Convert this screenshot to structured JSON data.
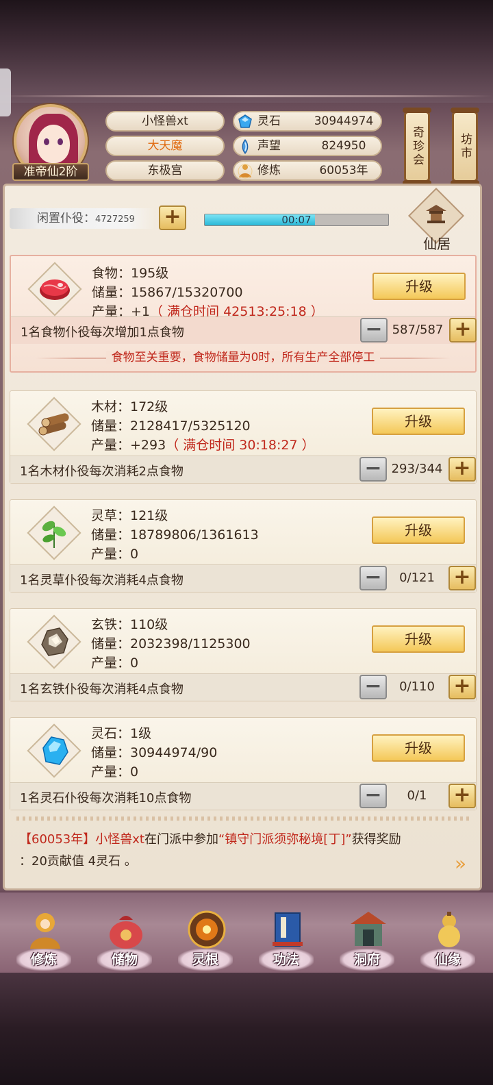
{
  "player": {
    "name": "小怪兽xt",
    "title": "大天魔",
    "location": "东极宫",
    "rank": "准帝仙2阶"
  },
  "resources": [
    {
      "icon": "spirit-stone-icon",
      "label": "灵石",
      "value": "30944974"
    },
    {
      "icon": "prestige-icon",
      "label": "声望",
      "value": "824950"
    },
    {
      "icon": "cultivation-icon",
      "label": "修炼",
      "value": "60053年"
    }
  ],
  "side_buttons": {
    "treasure": "奇珍会",
    "market": "坊市"
  },
  "idle": {
    "label": "闲置仆役：",
    "count": "4727259"
  },
  "timer": {
    "text": "00:07",
    "progress": 0.6
  },
  "xianju": {
    "label": "仙居"
  },
  "cards": [
    {
      "icon": "meat-icon",
      "name_line": "食物：195级",
      "storage_line": "储量：15867/15320700",
      "output_prefix": "产量：+1",
      "output_full": "（ 满仓时间 42513:25:18 ）",
      "upgrade": "升级",
      "work_desc": "1名食物仆役每次增加1点食物",
      "work_count": "587/587",
      "warning": "食物至关重要，食物储量为0时，所有生产全部停工"
    },
    {
      "icon": "wood-icon",
      "name_line": "木材：172级",
      "storage_line": "储量：2128417/5325120",
      "output_prefix": "产量：+293",
      "output_full": "（ 满仓时间 30:18:27 ）",
      "upgrade": "升级",
      "work_desc": "1名木材仆役每次消耗2点食物",
      "work_count": "293/344"
    },
    {
      "icon": "herb-icon",
      "name_line": "灵草：121级",
      "storage_line": "储量：18789806/1361613",
      "output_prefix": "产量：0",
      "output_full": "",
      "upgrade": "升级",
      "work_desc": "1名灵草仆役每次消耗4点食物",
      "work_count": "0/121"
    },
    {
      "icon": "iron-ore-icon",
      "name_line": "玄铁：110级",
      "storage_line": "储量：2032398/1125300",
      "output_prefix": "产量：0",
      "output_full": "",
      "upgrade": "升级",
      "work_desc": "1名玄铁仆役每次消耗4点食物",
      "work_count": "0/110"
    },
    {
      "icon": "crystal-icon",
      "name_line": "灵石：1级",
      "storage_line": "储量：30944974/90",
      "output_prefix": "产量：0",
      "output_full": "",
      "upgrade": "升级",
      "work_desc": "1名灵石仆役每次消耗10点食物",
      "work_count": "0/1"
    }
  ],
  "log": {
    "year": "【60053年】",
    "who": "小怪兽xt",
    "mid": "在门派中参加",
    "event": "“镇守门派须弥秘境[丁]”",
    "tail": "获得奖励",
    "reward": "：20贡献值 4灵石 。"
  },
  "nav": [
    {
      "icon": "meditate-icon",
      "label": "修炼"
    },
    {
      "icon": "bag-icon",
      "label": "储物"
    },
    {
      "icon": "spirit-root-icon",
      "label": "灵根"
    },
    {
      "icon": "book-icon",
      "label": "功法"
    },
    {
      "icon": "cave-icon",
      "label": "洞府"
    },
    {
      "icon": "gourd-icon",
      "label": "仙缘"
    }
  ],
  "colors": {
    "accent_red": "#c0281c",
    "orange": "#e06a10",
    "gold_button": "#f4c858",
    "progress": "#2ab8d8"
  }
}
